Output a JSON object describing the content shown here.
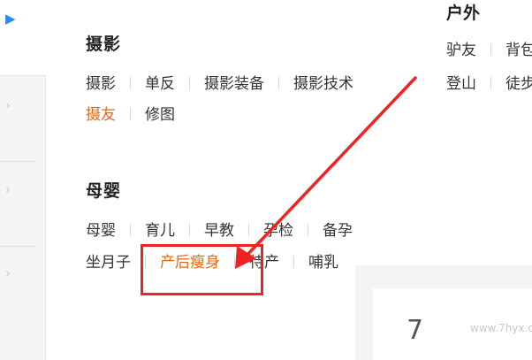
{
  "left_nav": {
    "items": [
      {
        "icon": "chevron-right-icon",
        "active": true
      },
      {
        "icon": "chevron-right-icon",
        "active": false
      },
      {
        "icon": "chevron-right-icon",
        "active": false
      },
      {
        "icon": "chevron-right-icon",
        "active": false
      }
    ]
  },
  "photography": {
    "title": "摄影",
    "row1": [
      "摄影",
      "单反",
      "摄影装备",
      "摄影技术"
    ],
    "row2": [
      "摄友",
      "修图"
    ],
    "highlighted": "摄友"
  },
  "maternity": {
    "title": "母婴",
    "row1": [
      "母婴",
      "育儿",
      "早教",
      "孕检",
      "备孕"
    ],
    "row2": [
      "坐月子",
      "产后瘦身",
      "待产",
      "哺乳"
    ],
    "highlighted": "产后瘦身"
  },
  "outdoor": {
    "title": "户外",
    "row1": [
      "驴友",
      "背包"
    ],
    "row2": [
      "登山",
      "徒步"
    ]
  },
  "watermark": {
    "number": "7",
    "url": "www.7hyx.com"
  },
  "colors": {
    "accent_blue": "#2a8be9",
    "hot_orange": "#e06a1a",
    "annotation_red": "#f02323"
  }
}
